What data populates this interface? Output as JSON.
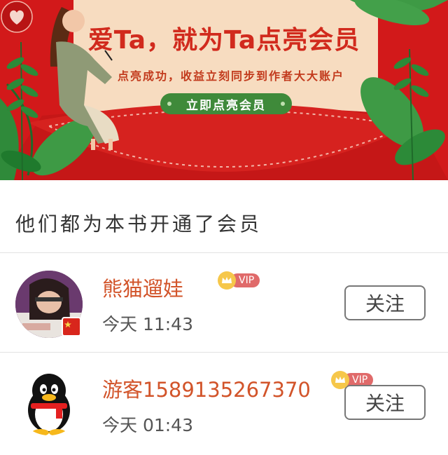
{
  "banner": {
    "title": "爱Ta，就为Ta点亮会员",
    "subtitle": "点亮成功，收益立刻同步到作者大大账户",
    "cta_label": "立即点亮会员"
  },
  "section": {
    "title": "他们都为本书开通了会员"
  },
  "members": [
    {
      "name": "熊猫遛娃",
      "vip": "VIP",
      "time": "今天 11:43",
      "follow_label": "关注"
    },
    {
      "name": "游客15891352673​70",
      "vip": "VIP",
      "time": "今天 01:43",
      "follow_label": "关注"
    }
  ],
  "colors": {
    "banner_red": "#d2191a",
    "cta_green": "#3f8a3a",
    "name_orange": "#d2542a"
  }
}
